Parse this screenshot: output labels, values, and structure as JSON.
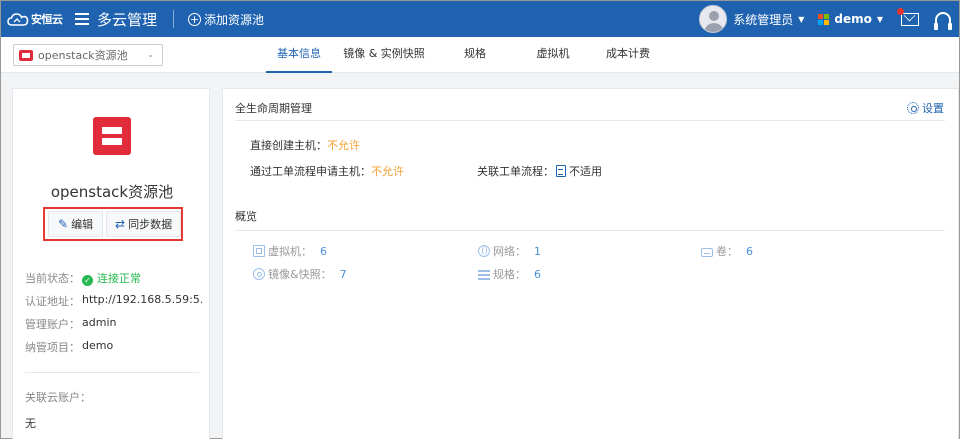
{
  "topbar": {
    "logo_text": "安恒云",
    "app_title": "多云管理",
    "add_pool_label": "添加资源池",
    "user_name": "系统管理员",
    "tenant_name": "demo",
    "icons": [
      "menu-icon",
      "plus-circle-icon",
      "avatar",
      "windows-icon",
      "mail-icon",
      "headset-icon"
    ],
    "colors": {
      "bar": "#1f63b0",
      "notification": "#e3342f"
    }
  },
  "subbar": {
    "pool_select_value": "openstack资源池",
    "tabs": [
      {
        "label": "基本信息",
        "active": true
      },
      {
        "label": "镜像 & 实例快照",
        "active": false
      },
      {
        "label": "规格",
        "active": false
      },
      {
        "label": "虚拟机",
        "active": false
      },
      {
        "label": "成本计费",
        "active": false
      }
    ]
  },
  "left_panel": {
    "pool_name": "openstack资源池",
    "edit_label": "编辑",
    "sync_label": "同步数据",
    "status_label": "当前状态：",
    "status_value": "连接正常",
    "auth_label": "认证地址：",
    "auth_value": "http://192.168.5.59:5...",
    "account_label": "管理账户：",
    "account_value": "admin",
    "project_label": "纳管项目：",
    "project_value": "demo",
    "linked_label": "关联云账户：",
    "linked_value": "无"
  },
  "right_panel": {
    "lifecycle_title": "全生命周期管理",
    "settings_label": "设置",
    "direct_create_label": "直接创建主机：",
    "direct_create_value": "不允许",
    "ticket_create_label": "通过工单流程申请主机：",
    "ticket_create_value": "不允许",
    "ticket_flow_label": "关联工单流程：",
    "ticket_flow_value": "不适用",
    "overview_title": "概览",
    "stats": [
      {
        "label": "虚拟机：",
        "value": "6",
        "icon": "vm-icon"
      },
      {
        "label": "网络：",
        "value": "1",
        "icon": "network-icon"
      },
      {
        "label": "卷：",
        "value": "6",
        "icon": "volume-icon"
      },
      {
        "label": "镜像&快照：",
        "value": "7",
        "icon": "image-icon"
      },
      {
        "label": "规格：",
        "value": "6",
        "icon": "spec-icon"
      }
    ]
  }
}
